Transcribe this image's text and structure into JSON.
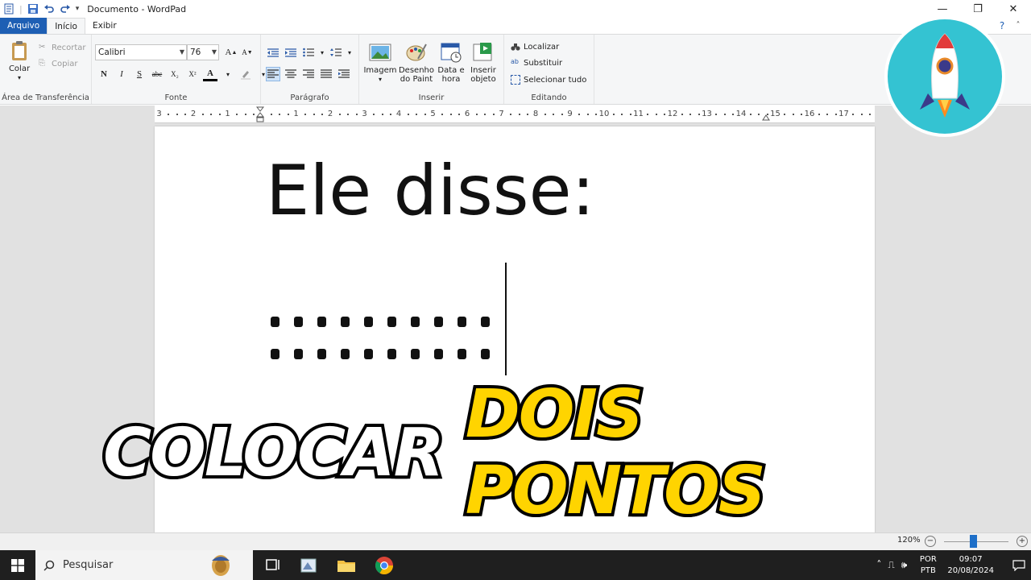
{
  "window": {
    "title": "Documento - WordPad",
    "controls": {
      "minimize": "—",
      "restore": "❐",
      "close": "✕"
    }
  },
  "tabs": [
    {
      "label": "Arquivo"
    },
    {
      "label": "Início"
    },
    {
      "label": "Exibir"
    }
  ],
  "ribbon": {
    "clipboard": {
      "label": "Área de Transferência",
      "paste": "Colar",
      "cut": "Recortar",
      "copy": "Copiar"
    },
    "font": {
      "label": "Fonte",
      "family": "Calibri",
      "size": "76",
      "bold": "N",
      "italic": "I",
      "underline": "S",
      "strike": "abc",
      "subscript": "X₂",
      "superscript": "X²"
    },
    "paragraph": {
      "label": "Parágrafo"
    },
    "insert": {
      "label": "Inserir",
      "image": "Imagem",
      "paint_line1": "Desenho",
      "paint_line2": "do Paint",
      "datetime_line1": "Data e",
      "datetime_line2": "hora",
      "object_line1": "Inserir",
      "object_line2": "objeto"
    },
    "editing": {
      "label": "Editando",
      "find": "Localizar",
      "replace": "Substituir",
      "select_all": "Selecionar tudo"
    }
  },
  "ruler": {
    "numbers_left": [
      "3",
      "2",
      "1"
    ],
    "numbers_right": [
      "1",
      "2",
      "3",
      "4",
      "5",
      "6",
      "7",
      "8",
      "9",
      "10",
      "11",
      "12",
      "13",
      "14",
      "15",
      "16",
      "17"
    ]
  },
  "document": {
    "line1": "Ele disse:",
    "dot_rows": 2,
    "dots_per_row": 10
  },
  "caption": {
    "white": "COLOCAR",
    "yellow": "DOIS PONTOS"
  },
  "status": {
    "zoom": "120%",
    "zoom_fraction": 0.45
  },
  "taskbar": {
    "search_placeholder": "Pesquisar",
    "lang_line1": "POR",
    "lang_line2": "PTB",
    "time": "09:07",
    "date": "20/08/2024"
  },
  "colors": {
    "accent": "#1e5fb4",
    "caption_yellow": "#ffd400",
    "logo_bg": "#34c3d2"
  }
}
